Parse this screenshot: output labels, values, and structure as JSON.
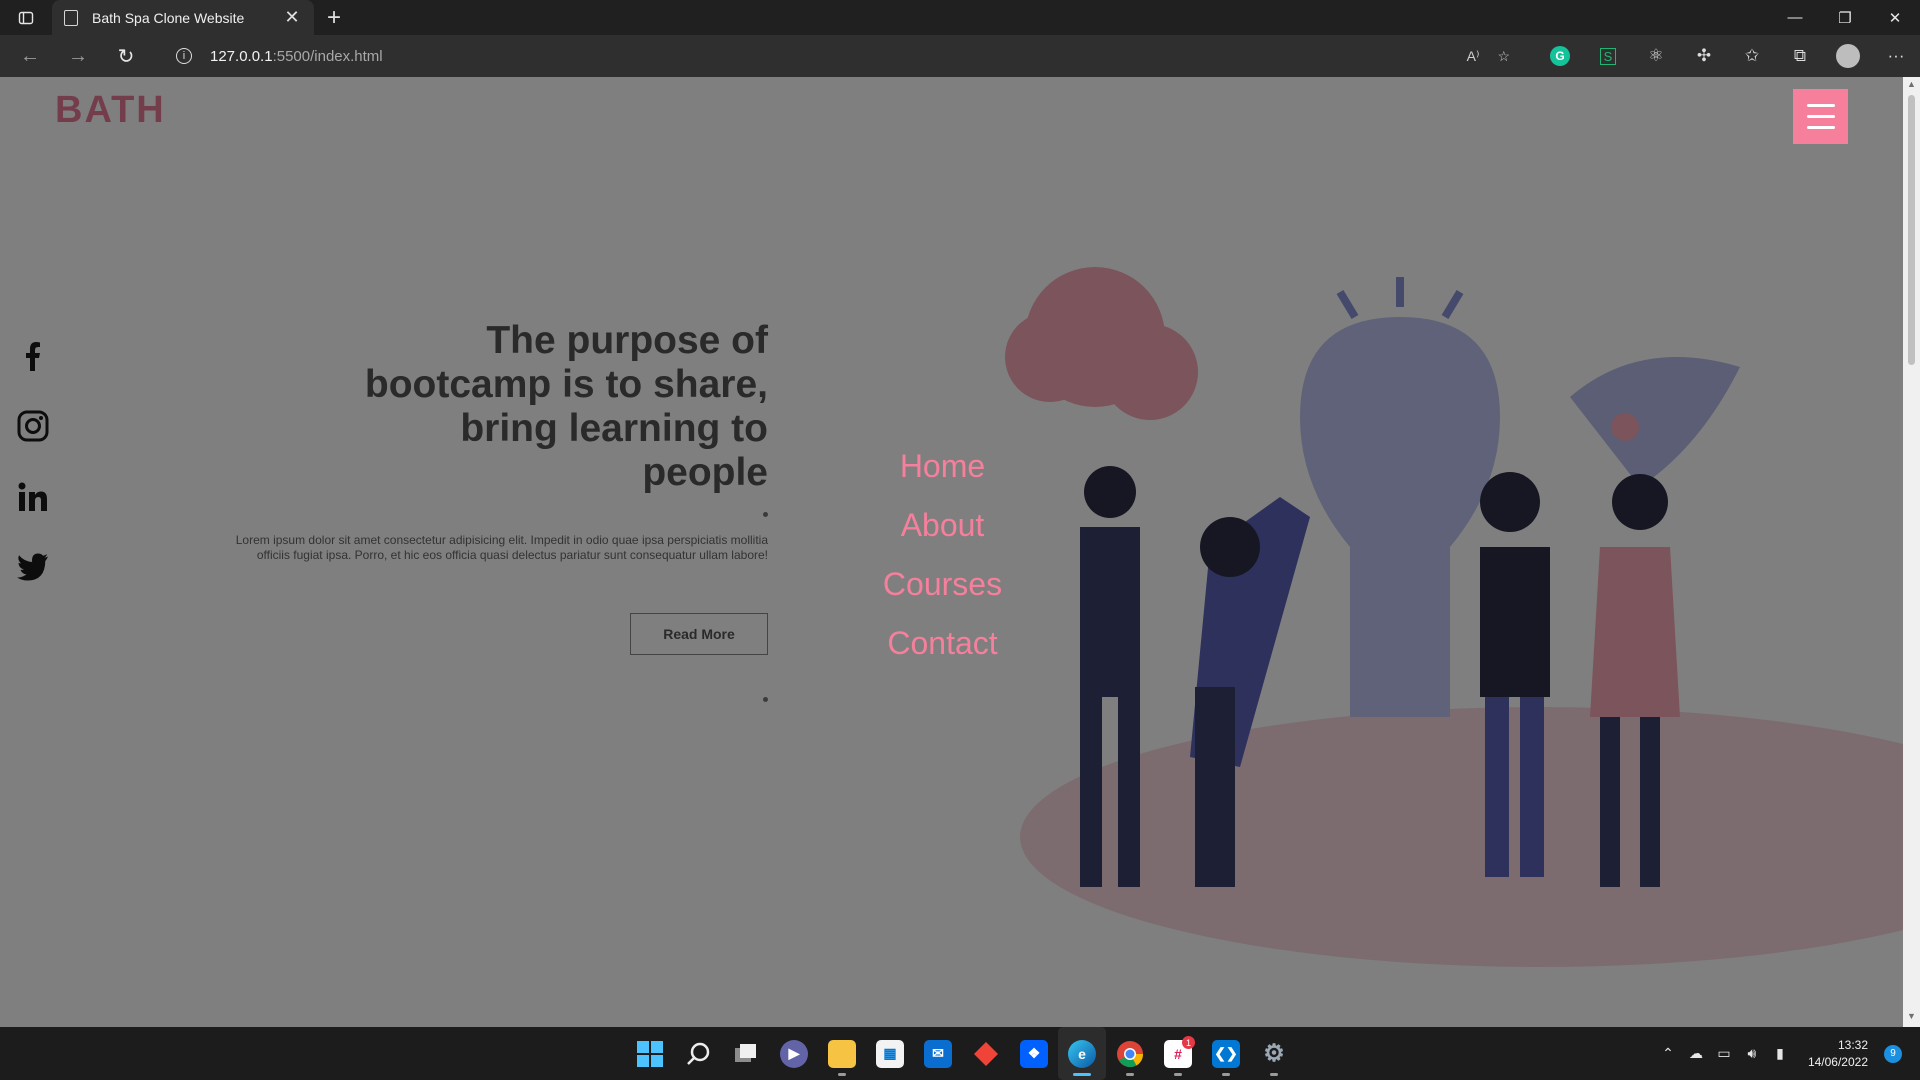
{
  "browser": {
    "tab_title": "Bath Spa Clone Website",
    "url_host": "127.0.0.1",
    "url_path": ":5500/index.html",
    "read_aloud": "A⁾"
  },
  "page": {
    "logo": "BATH",
    "hero_title": "The purpose of bootcamp is to share, bring learning to people",
    "hero_text": "Lorem ipsum dolor sit amet consectetur adipisicing elit. Impedit in odio quae ipsa perspiciatis mollitia officiis fugiat ipsa. Porro, et hic eos officia quasi delectus pariatur sunt consequatur ullam labore!",
    "hero_button": "Read More",
    "menu": [
      "Home",
      "About",
      "Courses",
      "Contact"
    ],
    "accent_color": "#f67f9c"
  },
  "taskbar": {
    "time": "13:32",
    "date": "14/06/2022",
    "notification_count": "9",
    "teams_badge": "1"
  }
}
